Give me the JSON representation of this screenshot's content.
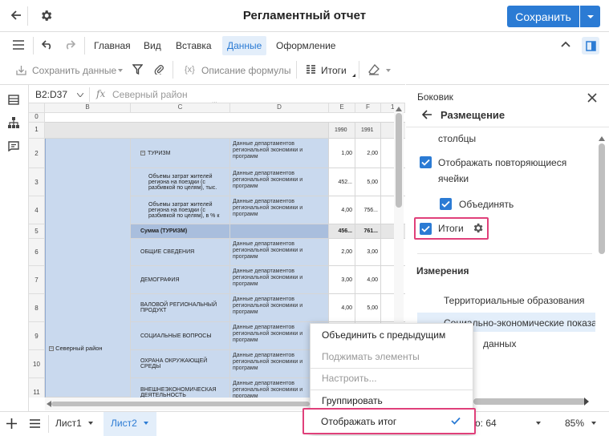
{
  "window": {
    "title": "Регламентный отчет",
    "save_label": "Сохранить"
  },
  "menu": {
    "items": [
      "Главная",
      "Вид",
      "Вставка",
      "Данные",
      "Оформление"
    ],
    "active": "Данные"
  },
  "toolbar": {
    "save_data": "Сохранить данные",
    "formula_desc": "Описание формулы",
    "totals": "Итоги"
  },
  "formula_bar": {
    "cell_ref": "B2:D37",
    "fx": "fx",
    "value": "Северный район"
  },
  "sheet": {
    "columns": [
      "B",
      "C",
      "D",
      "E",
      "F",
      "1"
    ],
    "row_numbers": [
      "0",
      "1",
      "2",
      "3",
      "4",
      "5",
      "6",
      "7",
      "8",
      "9",
      "10",
      "11"
    ],
    "year_e": "1990",
    "year_f": "1991",
    "region": "Северный район",
    "rows": [
      {
        "c": "ТУРИЗМ",
        "d": "Данные департаментов региональной экономики и программ",
        "e": "1,00",
        "f": "2,00"
      },
      {
        "c": "Объемы затрат жителей региона на поездки (с разбивкой по целям), тыс.",
        "d": "Данные департаментов региональной экономики и программ",
        "e": "452...",
        "f": "5,00"
      },
      {
        "c": "Объемы затрат жителей региона на поездки (с разбивкой по целям), в % к",
        "d": "Данные департаментов региональной экономики и программ",
        "e": "4,00",
        "f": "756..."
      },
      {
        "c": "Сумма (ТУРИЗМ)",
        "d": "",
        "e": "456...",
        "f": "761..."
      },
      {
        "c": "ОБЩИЕ СВЕДЕНИЯ",
        "d": "Данные департаментов региональной экономики и программ",
        "e": "2,00",
        "f": "3,00"
      },
      {
        "c": "ДЕМОГРАФИЯ",
        "d": "Данные департаментов региональной экономики и программ",
        "e": "3,00",
        "f": "4,00"
      },
      {
        "c": "ВАЛОВОЙ РЕГИОНАЛЬНЫЙ ПРОДУКТ",
        "d": "Данные департаментов региональной экономики и программ",
        "e": "4,00",
        "f": "5,00"
      },
      {
        "c": "СОЦИАЛЬНЫЕ ВОПРОСЫ",
        "d": "Данные департаментов региональной экономики и программ",
        "e": "",
        "f": ""
      },
      {
        "c": "ОХРАНА ОКРУЖАЮЩЕЙ СРЕДЫ",
        "d": "Данные департаментов региональной экономики и программ",
        "e": "",
        "f": ""
      },
      {
        "c": "ВНЕШНЕЭКОНОМИЧЕСКАЯ ДЕЯТЕЛЬНОСТЬ",
        "d": "Данные департаментов региональной экономики и программ",
        "e": "",
        "f": ""
      }
    ]
  },
  "panel": {
    "header": "Боковик",
    "section": "Размещение",
    "item_columns": "столбцы",
    "show_repeating_line1": "Отображать повторяющиеся",
    "show_repeating_line2": "ячейки",
    "merge": "Объединять",
    "totals": "Итоги",
    "dimensions_title": "Измерения",
    "dim1": "Территориальные образования",
    "dim2": "Социально-экономические показа",
    "dim3": "данных"
  },
  "context_menu": {
    "merge_prev": "Объединить с предыдущим",
    "collapse": "Поджимать элементы",
    "configure": "Настроить...",
    "group": "Группировать",
    "show_total": "Отображать итог"
  },
  "bottombar": {
    "sheet1": "Лист1",
    "sheet2": "Лист2",
    "status": "о: 64",
    "zoom": "85%"
  },
  "colors": {
    "accent": "#2b7bd4",
    "highlight": "#e0407a",
    "selection": "#c9d9ee"
  }
}
